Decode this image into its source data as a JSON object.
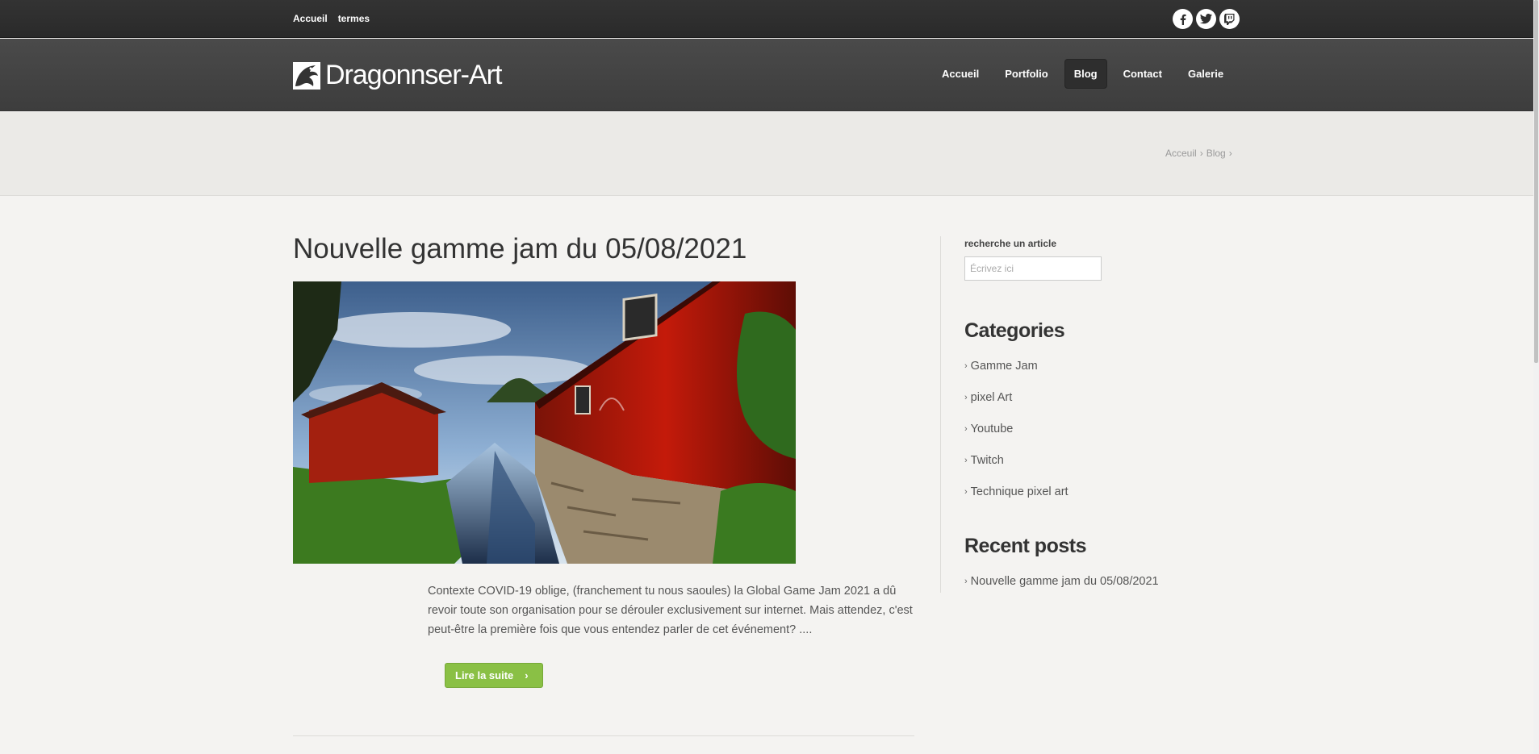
{
  "topbar": {
    "links": [
      "Accueil",
      "termes"
    ],
    "social": [
      "facebook-icon",
      "twitter-icon",
      "twitch-icon"
    ]
  },
  "header": {
    "site_name": "Dragonnser-Art",
    "nav": [
      {
        "label": "Accueil",
        "active": false
      },
      {
        "label": "Portfolio",
        "active": false
      },
      {
        "label": "Blog",
        "active": true
      },
      {
        "label": "Contact",
        "active": false
      },
      {
        "label": "Galerie",
        "active": false
      }
    ]
  },
  "breadcrumb": {
    "items": [
      "Acceuil",
      "Blog"
    ],
    "separator": "›"
  },
  "post": {
    "title": "Nouvelle gamme jam du 05/08/2021",
    "excerpt": "Contexte COVID-19 oblige, (franchement tu nous saoules) la Global Game Jam 2021 a dû revoir toute son organisation pour se dérouler exclusivement sur internet. Mais attendez, c'est peut-être la première fois que vous entendez parler de cet événement? ....",
    "read_more": "Lire la suite",
    "read_more_arrow": "›"
  },
  "sidebar": {
    "search_label": "recherche un article",
    "search_placeholder": "Écrivez ici",
    "categories_title": "Categories",
    "categories": [
      "Gamme Jam",
      "pixel Art",
      "Youtube",
      "Twitch",
      "Technique pixel art"
    ],
    "recent_title": "Recent posts",
    "recent": [
      "Nouvelle gamme jam du 05/08/2021"
    ],
    "bullet": "›"
  },
  "colors": {
    "accent": "#8ac045",
    "topbar": "#2f2f2f",
    "header": "#444444",
    "background": "#f4f3f1"
  }
}
